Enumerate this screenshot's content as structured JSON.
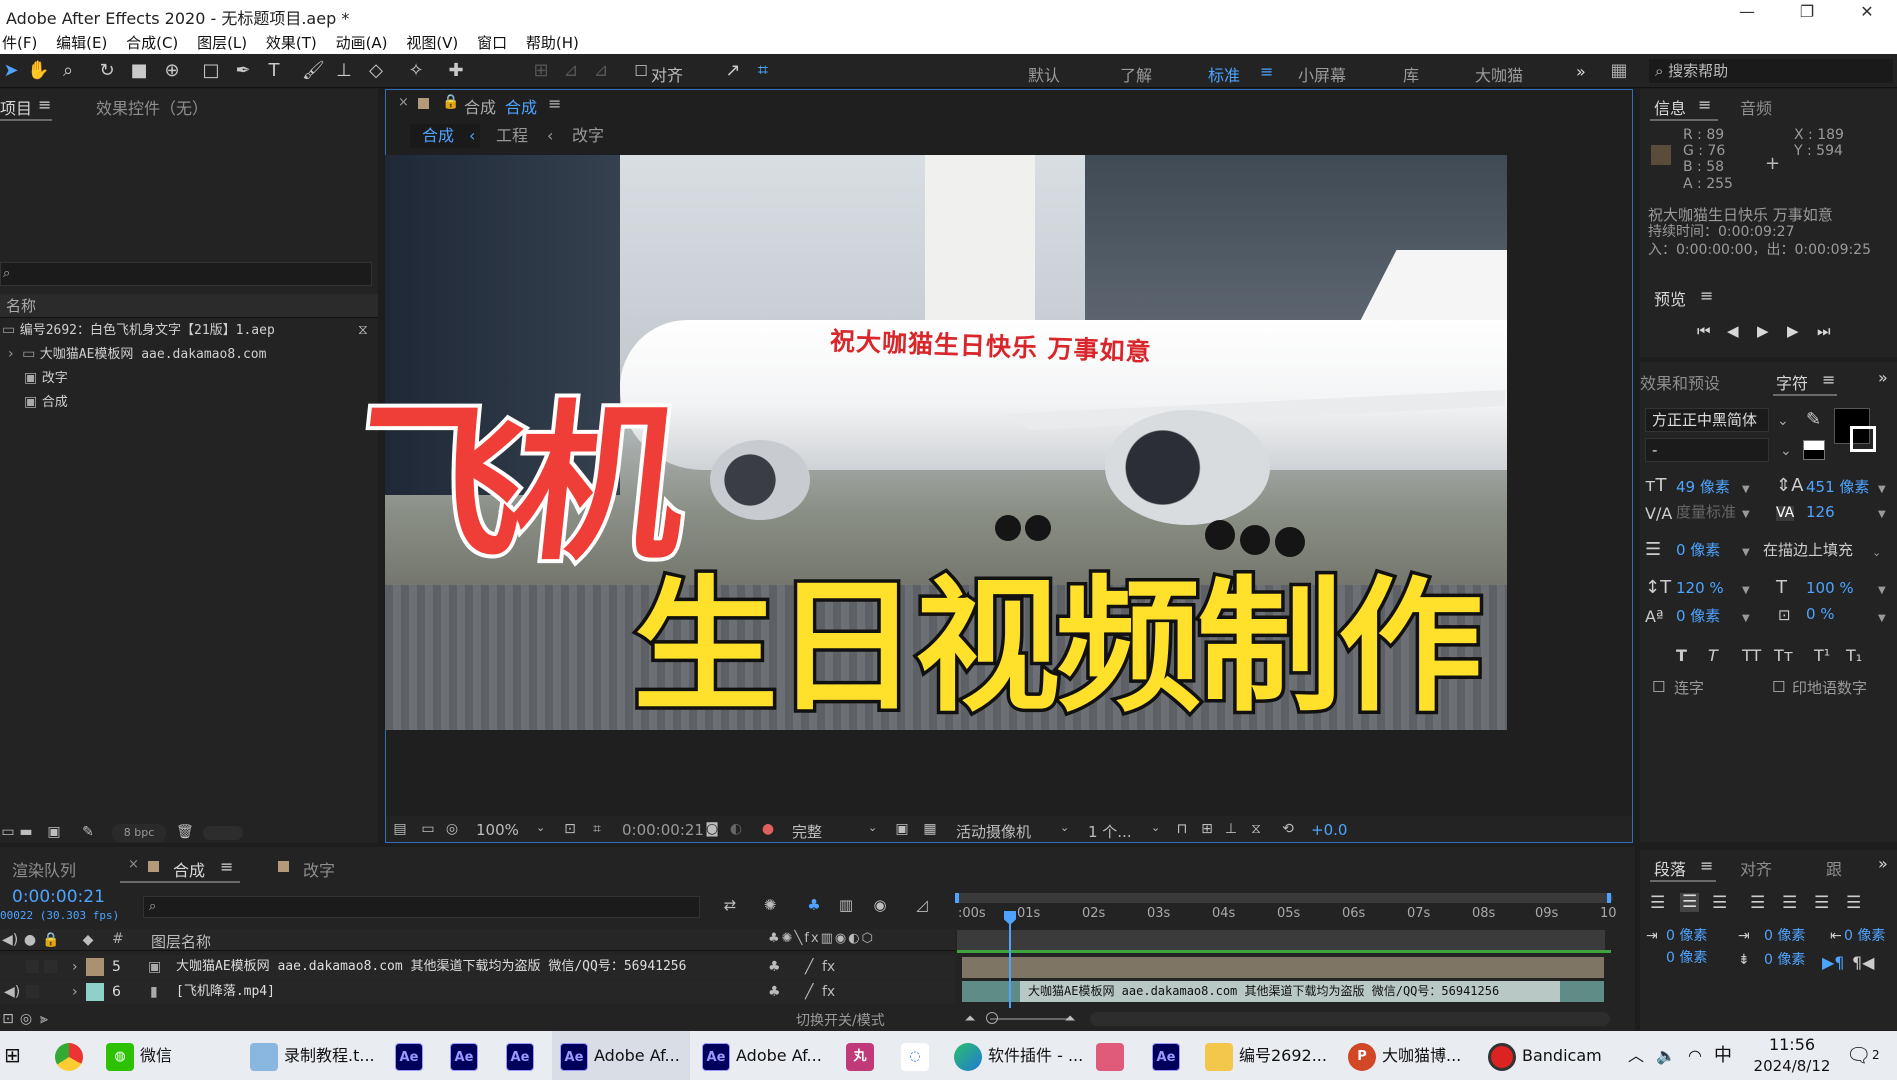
{
  "window": {
    "title": "Adobe After Effects 2020 - 无标题项目.aep *",
    "min": "—",
    "max": "❐",
    "close": "✕"
  },
  "menu": [
    "件(F)",
    "编辑(E)",
    "合成(C)",
    "图层(L)",
    "效果(T)",
    "动画(A)",
    "视图(V)",
    "窗口",
    "帮助(H)"
  ],
  "toolbar": {
    "align_label": "对齐",
    "workspaces": [
      "默认",
      "了解",
      "标准",
      "小屏幕",
      "库",
      "大咖猫"
    ],
    "active_workspace": "标准",
    "more": "»",
    "search_help": "搜索帮助"
  },
  "project_panel": {
    "tab_project": "项目",
    "tab_effects": "效果控件（无）",
    "column_name": "名称",
    "items": [
      "编号2692：白色飞机身文字【21版】1.aep",
      "大咖猫AE模板网 aae.dakamao8.com",
      "改字",
      "合成"
    ],
    "bpc": "8 bpc"
  },
  "comp_panel": {
    "tab_prefix": "合成",
    "tab_name": "合成",
    "breadcrumbs": [
      "合成",
      "工程",
      "改字"
    ],
    "plane_text": "祝大咖猫生日快乐 万事如意",
    "overlay_red": "飞机",
    "overlay_yellow": "生日视频制作",
    "zoom": "100%",
    "timecode": "0:00:00:21",
    "quality": "完整",
    "camera": "活动摄像机",
    "views": "1 个...",
    "exposure": "+0.0"
  },
  "info_panel": {
    "tab_info": "信息",
    "tab_audio": "音频",
    "r": "R : 89",
    "g": "G : 76",
    "b": "B : 58",
    "a": "A : 255",
    "x": "X : 189",
    "y": "Y : 594",
    "swatch_color": "#594c3a",
    "text_line": "祝大咖猫生日快乐 万事如意",
    "duration": "持续时间：0:00:09:27",
    "inout": "入：0:00:00:00，出：0:00:09:25"
  },
  "preview_panel": {
    "title": "预览"
  },
  "character_panel": {
    "tab_effects": "效果和预设",
    "tab_char": "字符",
    "font": "方正正中黑简体",
    "style": "-",
    "size": "49 像素",
    "leading": "451 像素",
    "kerning": "度量标准",
    "tracking": "126",
    "stroke": "0 像素",
    "stroke_mode": "在描边上填充",
    "vscale": "120 %",
    "hscale": "100 %",
    "baseline": "0 像素",
    "tsume": "0 %",
    "ligature": "连字",
    "hindi": "印地语数字"
  },
  "paragraph_panel": {
    "tab_para": "段落",
    "tab_align": "对齐",
    "tab_track": "跟",
    "indent_left": "0 像素",
    "indent_first": "0 像素",
    "indent_right": "0 像素",
    "space_before": "0 像素",
    "space_after": "0 像素"
  },
  "timeline": {
    "tab_render": "渲染队列",
    "tab_comp": "合成",
    "tab_other": "改字",
    "timecode": "0:00:00:21",
    "fps": "00022 (30.303 fps)",
    "col_num": "#",
    "col_name": "图层名称",
    "ruler": [
      ":00s",
      "01s",
      "02s",
      "03s",
      "04s",
      "05s",
      "06s",
      "07s",
      "08s",
      "09s",
      "10"
    ],
    "layers": [
      {
        "num": "5",
        "name": "大咖猫AE模板网 aae.dakamao8.com  其他渠道下载均为盗版 微信/QQ号：56941256",
        "color": "#a89272"
      },
      {
        "num": "6",
        "name": "[飞机降落.mp4]",
        "color": "#8fd0c8"
      }
    ],
    "track_label": "大咖猫AE模板网 aae.dakamao8.com  其他渠道下载均为盗版  微信/QQ号：56941256",
    "switch_mode": "切换开关/模式"
  },
  "taskbar": {
    "items": [
      "微信",
      "录制教程.t...",
      "Adobe Af...",
      "Adobe Af...",
      "软件插件 - ...",
      "编号2692...",
      "大咖猫博...",
      "Bandicam"
    ],
    "ime": "中",
    "time": "11:56",
    "date": "2024/8/12",
    "notif": "2"
  }
}
